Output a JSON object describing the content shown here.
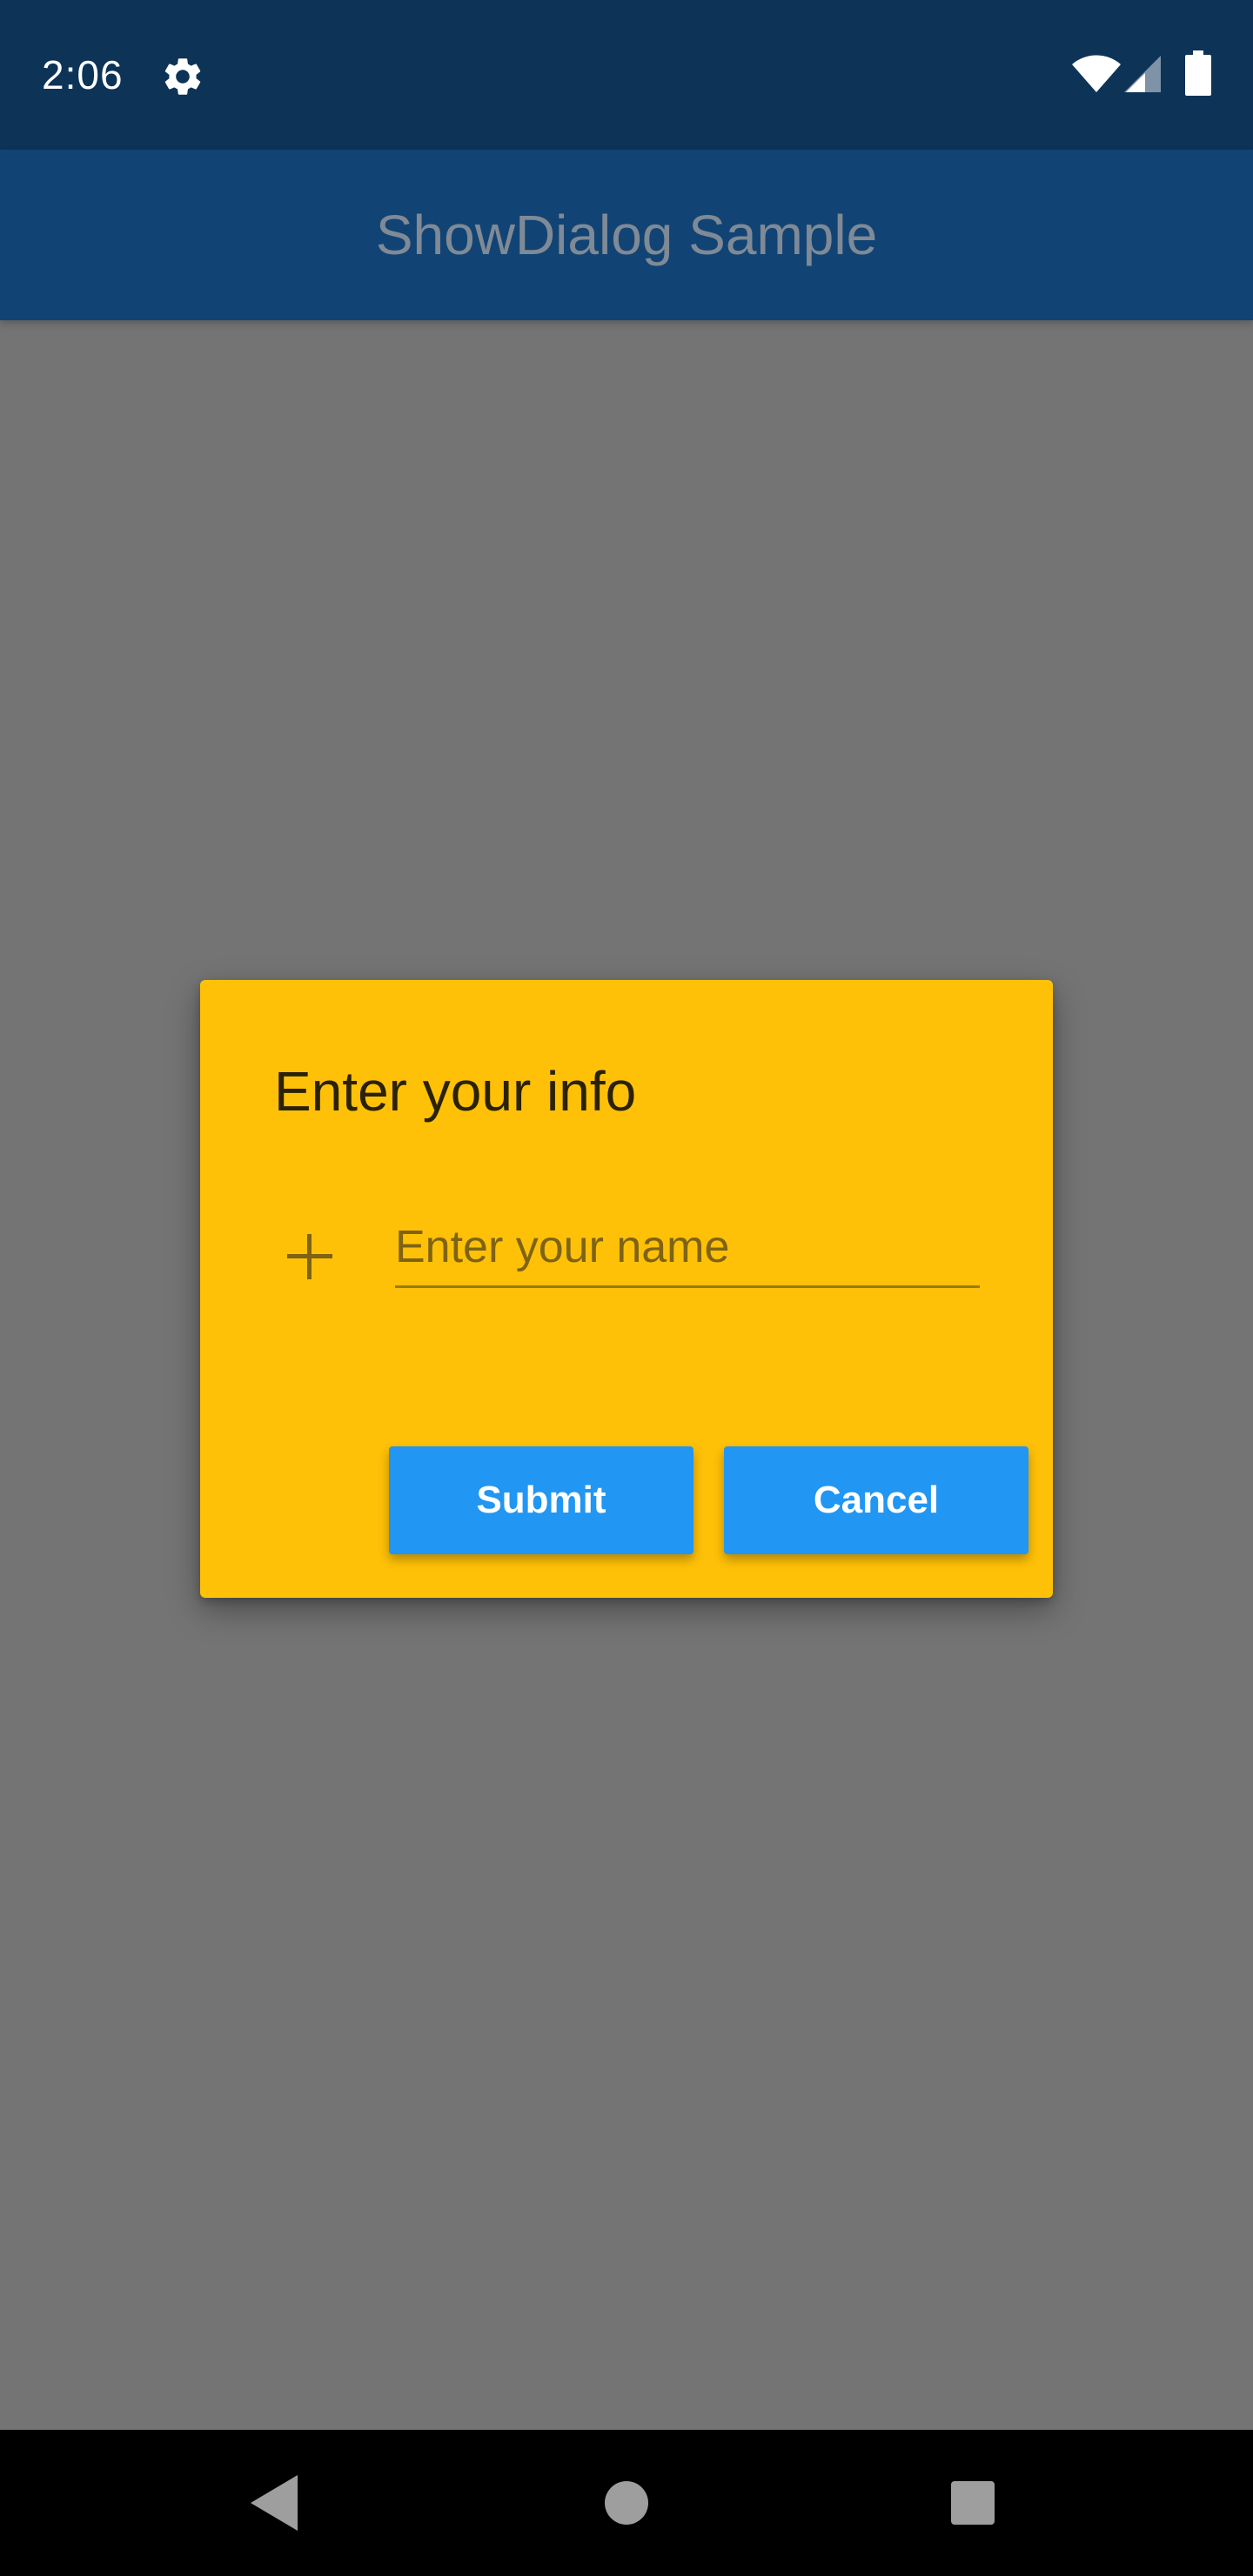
{
  "status_bar": {
    "time": "2:06",
    "icons": [
      "gear-icon",
      "wifi-icon",
      "signal-icon",
      "battery-icon"
    ]
  },
  "app_bar": {
    "title": "ShowDialog Sample"
  },
  "dialog": {
    "title": "Enter your info",
    "field_icon": "add-icon",
    "name_field": {
      "value": "",
      "placeholder": "Enter your name"
    },
    "submit_label": "Submit",
    "cancel_label": "Cancel"
  },
  "nav_bar": {
    "icons": [
      "back-icon",
      "home-icon",
      "recents-icon"
    ]
  },
  "colors": {
    "status_bar": "#0d3357",
    "app_bar": "#114474",
    "scrim_background": "#747474",
    "dialog_background": "#ffc107",
    "button": "#2196f3",
    "button_text": "#ffffff",
    "nav_bar": "#000000"
  }
}
